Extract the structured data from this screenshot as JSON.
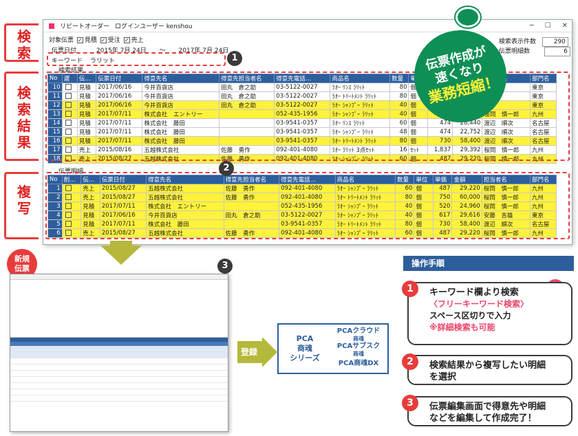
{
  "side_labels": {
    "search": "検索",
    "result": "検索結果",
    "copy": "複写"
  },
  "window": {
    "title": "リピートオーダー",
    "login": "ログインユーザー kenshou",
    "target_label": "対象伝票",
    "chk_mitsumori": "見積",
    "chk_juchu": "受注",
    "chk_uriage": "売上",
    "date_label": "伝票日付",
    "date_from": "2015年 7月 24日",
    "date_sep": "～",
    "date_to": "2017年 7月 24日",
    "kw_label": "キーワード",
    "kw_value": "ラリット",
    "count_label": "検索表示件数",
    "count_value": "290",
    "detail_count_label": "伝票明細数",
    "detail_count_value": "6",
    "result_caption": "検索結果",
    "detail_caption": "伝票明細"
  },
  "result_table": {
    "headers": [
      "No",
      "選",
      "伝…",
      "伝票日付",
      "得意先名",
      "得意先担当者名",
      "得意先電話…",
      "商品名",
      "数量",
      "単位",
      "単価",
      "金額",
      "担当者名",
      "部門名"
    ],
    "rows": [
      {
        "no": "10",
        "chk": "",
        "type": "見積",
        "date": "2017/06/16",
        "cust": "今井百貨店",
        "rep": "田丸　倉之助",
        "tel": "03-5122-0027",
        "item": "ﾗｵｰ ﾘﾝｽ ﾗﾘｯﾄ",
        "qty": "80",
        "unit": "個",
        "price": "5…",
        "amt": "",
        "staff": "",
        "dept": "東京",
        "hl": "w"
      },
      {
        "no": "11",
        "chk": "",
        "type": "見積",
        "date": "2017/06/16",
        "cust": "今井百貨店",
        "rep": "田丸　倉之助",
        "tel": "03-5122-0027",
        "item": "ﾗｵｰ ﾄﾘｰﾄﾒﾝﾄ ﾗﾘｯﾄ",
        "qty": "80",
        "unit": "個",
        "price": "800",
        "amt": "",
        "staff": "",
        "dept": "東京",
        "hl": "w"
      },
      {
        "no": "12",
        "chk": "",
        "type": "見積",
        "date": "2017/06/16",
        "cust": "今井百貨店",
        "rep": "田丸　倉之助",
        "tel": "03-5122-0027",
        "item": "ﾗｵｰ ｼｬﾝﾌﾟｰ ﾗﾘｯﾄ",
        "qty": "40",
        "unit": "個",
        "price": "617",
        "amt": "",
        "staff": "",
        "dept": "東京",
        "hl": "y"
      },
      {
        "no": "13",
        "chk": "",
        "type": "見積",
        "date": "2017/07/11",
        "cust": "株式会社　エントリー",
        "rep": "",
        "tel": "052-435-1956",
        "item": "ﾗｵｰ ｼｬﾝﾌﾟｰ ﾗﾘｯﾄ",
        "qty": "40",
        "unit": "個",
        "price": "520",
        "amt": "24,960",
        "staff": "桜岡　慎一郎",
        "dept": "九州",
        "hl": "y"
      },
      {
        "no": "14",
        "chk": "",
        "type": "見積",
        "date": "2017/07/11",
        "cust": "株式会社　藤田",
        "rep": "",
        "tel": "03-9541-0357",
        "item": "ﾗｵｰ ﾘﾝｽ ﾗﾘｯﾄ",
        "qty": "60",
        "unit": "個",
        "price": "474",
        "amt": "28,440",
        "staff": "渡辺　順次",
        "dept": "名古屋",
        "hl": "w"
      },
      {
        "no": "15",
        "chk": "",
        "type": "見積",
        "date": "2017/07/11",
        "cust": "株式会社　藤田",
        "rep": "",
        "tel": "03-9541-0357",
        "item": "ﾗｵｰ ｼｬﾝﾌﾟｰ ﾗﾘｯﾄ",
        "qty": "48",
        "unit": "個",
        "price": "474",
        "amt": "22,752",
        "staff": "渡辺　順次",
        "dept": "名古屋",
        "hl": "w"
      },
      {
        "no": "16",
        "chk": "",
        "type": "見積",
        "date": "2017/07/11",
        "cust": "株式会社　藤田",
        "rep": "",
        "tel": "03-9541-0357",
        "item": "ﾗｵｰ ﾄﾘｰﾄﾒﾝﾄ ﾗﾘｯﾄ",
        "qty": "80",
        "unit": "個",
        "price": "730",
        "amt": "58,400",
        "staff": "渡辺　順次",
        "dept": "名古屋",
        "hl": "y"
      },
      {
        "no": "17",
        "chk": "",
        "type": "売上",
        "date": "2015/08/16",
        "cust": "五越株式会社",
        "rep": "佐藤　勇作",
        "tel": "092-401-4080",
        "item": "ﾗｵｰ ﾗﾘｯﾄ 3点ｾｯﾄ",
        "qty": "16",
        "unit": "ｾｯﾄ",
        "price": "1,837",
        "amt": "29,392",
        "staff": "桜岡　慎一郎",
        "dept": "九州",
        "hl": "w"
      },
      {
        "no": "18",
        "chk": "",
        "type": "売上",
        "date": "2015/08/27",
        "cust": "五越株式会社",
        "rep": "佐藤　勇作",
        "tel": "092-401-4080",
        "item": "ﾗｵｰ ｼｬﾝﾌﾟｰ ﾗﾘｯﾄ",
        "qty": "60",
        "unit": "個",
        "price": "487",
        "amt": "29,220",
        "staff": "桜岡　慎一郎",
        "dept": "九州",
        "hl": "y"
      }
    ]
  },
  "detail_table": {
    "headers": [
      "No",
      "削…",
      "伝…",
      "伝票日付",
      "得意先名",
      "得意先担当者名",
      "得意先電話…",
      "商品名",
      "数量",
      "単位",
      "単価",
      "金額",
      "担当者名",
      "部門名"
    ],
    "rows": [
      {
        "no": "1",
        "type": "売上",
        "date": "2015/08/27",
        "cust": "五越株式会社",
        "rep": "佐藤　勇作",
        "tel": "092-401-4080",
        "item": "ﾗｵｰ ｼｬﾝﾌﾟｰ ﾗﾘｯﾄ",
        "qty": "60",
        "unit": "個",
        "price": "487",
        "amt": "29,220",
        "staff": "桜岡　慎一郎",
        "dept": "九州"
      },
      {
        "no": "2",
        "type": "売上",
        "date": "2015/08/27",
        "cust": "五越株式会社",
        "rep": "佐藤　勇作",
        "tel": "092-401-4080",
        "item": "ﾗｵｰ ﾄﾘｰﾄﾒﾝﾄ ﾗﾘｯﾄ",
        "qty": "80",
        "unit": "個",
        "price": "750",
        "amt": "60,000",
        "staff": "桜岡　慎一郎",
        "dept": "九州"
      },
      {
        "no": "3",
        "type": "見積",
        "date": "2017/07/11",
        "cust": "株式会社　エントリー",
        "rep": "",
        "tel": "052-435-1956",
        "item": "ﾗｵｰ ｼｬﾝﾌﾟｰ ﾗﾘｯﾄ",
        "qty": "40",
        "unit": "個",
        "price": "520",
        "amt": "24,960",
        "staff": "桜岡　慎一郎",
        "dept": "九州"
      },
      {
        "no": "4",
        "type": "見積",
        "date": "2017/06/16",
        "cust": "今井百貨店",
        "rep": "田丸　倉之助",
        "tel": "03-5122-0027",
        "item": "ﾗｵｰ ｼｬﾝﾌﾟｰ ﾗﾘｯﾄ",
        "qty": "40",
        "unit": "個",
        "price": "617",
        "amt": "29,616",
        "staff": "安藤　吉雄",
        "dept": "東京"
      },
      {
        "no": "5",
        "type": "見積",
        "date": "2017/07/11",
        "cust": "株式会社　藤田",
        "rep": "",
        "tel": "03-9541-0357",
        "item": "ﾗｵｰ ﾄﾘｰﾄﾒﾝﾄ ﾗﾘｯﾄ",
        "qty": "80",
        "unit": "個",
        "price": "730",
        "amt": "58,400",
        "staff": "渡辺　順次",
        "dept": "名古屋"
      },
      {
        "no": "6",
        "type": "売上",
        "date": "2015/08/27",
        "cust": "五越株式会社",
        "rep": "佐藤　勇作",
        "tel": "092-401-4080",
        "item": "ﾗｵｰ ｼｬﾝﾌﾟｰ ﾗﾘｯﾄ",
        "qty": "60",
        "unit": "個",
        "price": "487",
        "amt": "29,220",
        "staff": "桜岡　慎一郎",
        "dept": "九州"
      }
    ]
  },
  "stamp": {
    "line1": "伝票作成が",
    "line2": "速くなり",
    "line3": "業務短縮！"
  },
  "new_badge": {
    "line1": "新規",
    "line2": "伝票"
  },
  "register_label": "登録",
  "pca": {
    "left1": "PCA",
    "left2": "商魂",
    "left3": "シリーズ",
    "cloud": "PCAクラウド",
    "cloud_sub": "商魂",
    "subsc": "PCAサブスク",
    "subsc_sub": "商魂",
    "dx": "PCA商魂DX"
  },
  "op": {
    "title": "操作手順",
    "step1_main": "キーワード欄より検索",
    "step1_sub": "〈フリーキーワード検索〉",
    "step1_detail": "スペース区切りで入力",
    "step1_note": "※詳細検索も可能",
    "step2_line1": "検索結果から複写したい明細",
    "step2_line2": "を選択",
    "step3_line1": "伝票編集画面で得意先や明細",
    "step3_line2": "などを編集して作成完了！"
  },
  "callouts": {
    "n1": "1",
    "n2": "2",
    "n3": "3",
    "s1": "1",
    "s2": "2",
    "s3": "3"
  }
}
